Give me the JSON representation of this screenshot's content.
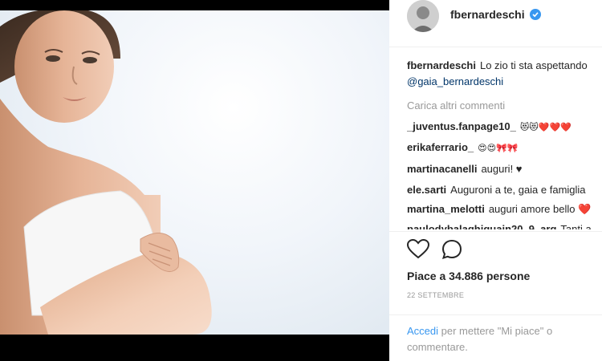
{
  "post": {
    "username": "fbernardeschi",
    "caption_text": "Lo zio ti sta aspettando",
    "caption_mention": "@gaia_bernardeschi",
    "load_more": "Carica altri commenti",
    "likes": "Piace a 34.886 persone",
    "date": "22 SETTEMBRE",
    "login_link": "Accedi",
    "login_rest": " per mettere \"Mi piace\" o commentare."
  },
  "comments": [
    {
      "user": "_juventus.fanpage10_",
      "text": "😻😻❤️❤️❤️"
    },
    {
      "user": "erikaferrario_",
      "text": "😍😍🎀🎀"
    },
    {
      "user": "martinacanelli",
      "text": "auguri! ♥"
    },
    {
      "user": "ele.sarti",
      "text": "Auguroni a te, gaia e famiglia"
    },
    {
      "user": "martina_melotti",
      "text": "auguri amore bello ❤️"
    },
    {
      "user": "paulodybalaghiguain20_9_arg",
      "text": "Tanti a"
    }
  ],
  "colors": {
    "accent_blue": "#3897f0",
    "text_dark": "#262626",
    "text_muted": "#999999",
    "heart_pink": "#ed4956"
  },
  "icons": [
    "verified-badge-icon",
    "heart-icon",
    "comment-bubble-icon"
  ]
}
